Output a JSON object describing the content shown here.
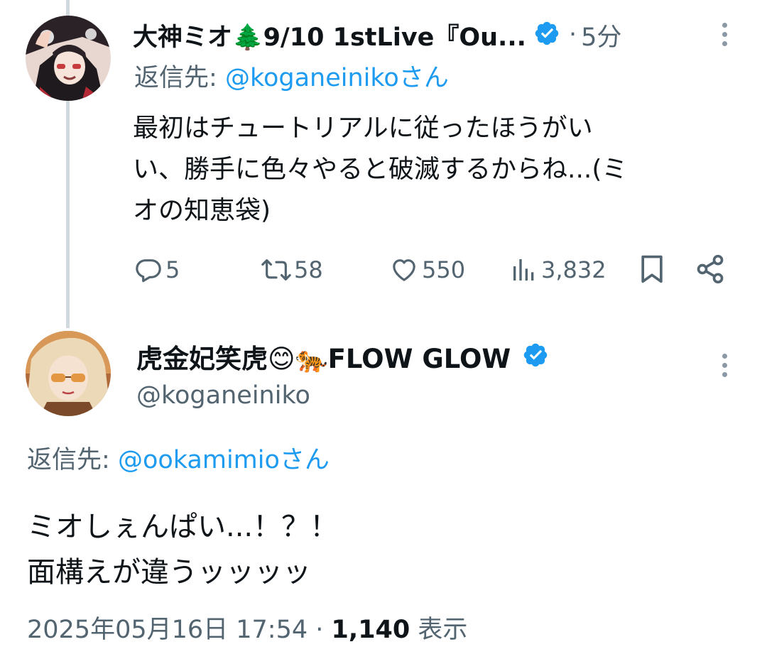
{
  "tweet1": {
    "display_name": "大神ミオ🌲9/10 1stLive『Ou...",
    "time": "5分",
    "reply_prefix": "返信先:",
    "reply_handle": "@koganeinikoさん",
    "text_line1": "最初はチュートリアルに従ったほうがい",
    "text_line2": "い、勝手に色々やると破滅するからね...(ミ",
    "text_line3": "オの知恵袋)",
    "replies": "5",
    "retweets": "58",
    "likes": "550",
    "views": "3,832"
  },
  "tweet2": {
    "display_name": "虎金妃笑虎😊🐅FLOW GLOW",
    "handle": "@koganeiniko",
    "reply_prefix": "返信先:",
    "reply_handle": "@ookamimioさん",
    "text_line1": "ミオしぇんぱい...！？！",
    "text_line2": "面構えが違うッッッッ",
    "timestamp": "2025年05月16日 17:54",
    "view_count": "1,140",
    "view_label": "表示"
  },
  "colors": {
    "accent": "#1d9bf0",
    "muted": "#536471",
    "verified": "#1d9bf0",
    "thread_line": "#cfd9de"
  },
  "icons": {
    "reply": "reply-icon",
    "retweet": "retweet-icon",
    "like": "heart-icon",
    "views": "views-icon",
    "bookmark": "bookmark-icon",
    "share": "share-icon",
    "more": "more-vertical-icon",
    "verified": "verified-badge-icon"
  }
}
